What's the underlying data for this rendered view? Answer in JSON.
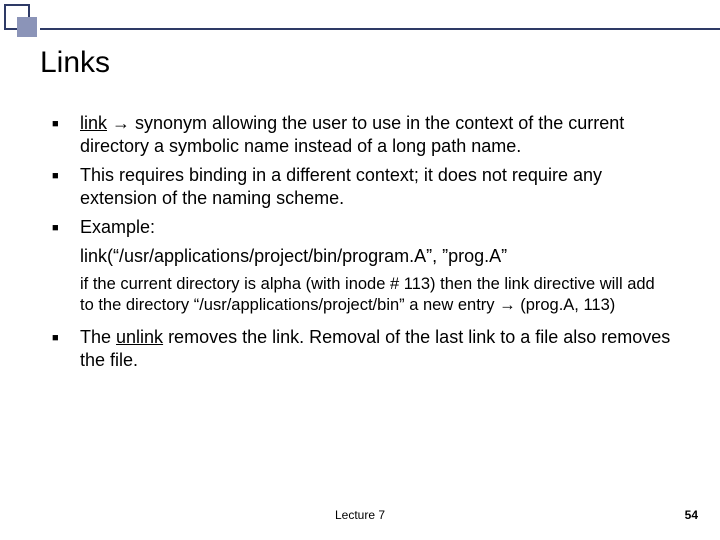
{
  "title": "Links",
  "bullets": {
    "b1_link": "link",
    "b1_rest": " → synonym allowing the user to use in the context of the current directory a symbolic name instead of a long path name.",
    "b2": "This requires binding in a different context; it does not require any extension of the naming scheme.",
    "b3": "Example:",
    "code": "link(“/usr/applications/project/bin/program.A”, ”prog.A”",
    "sub": "if the current directory is alpha (with inode # 113) then the link directive will add to the directory “/usr/applications/project/bin” a new entry → (prog.A, 113)",
    "b4_pre": "The ",
    "b4_unlink": "unlink",
    "b4_post": " removes the link. Removal of the last link to a file also removes the file."
  },
  "footer": {
    "center": "Lecture 7",
    "page": "54"
  }
}
